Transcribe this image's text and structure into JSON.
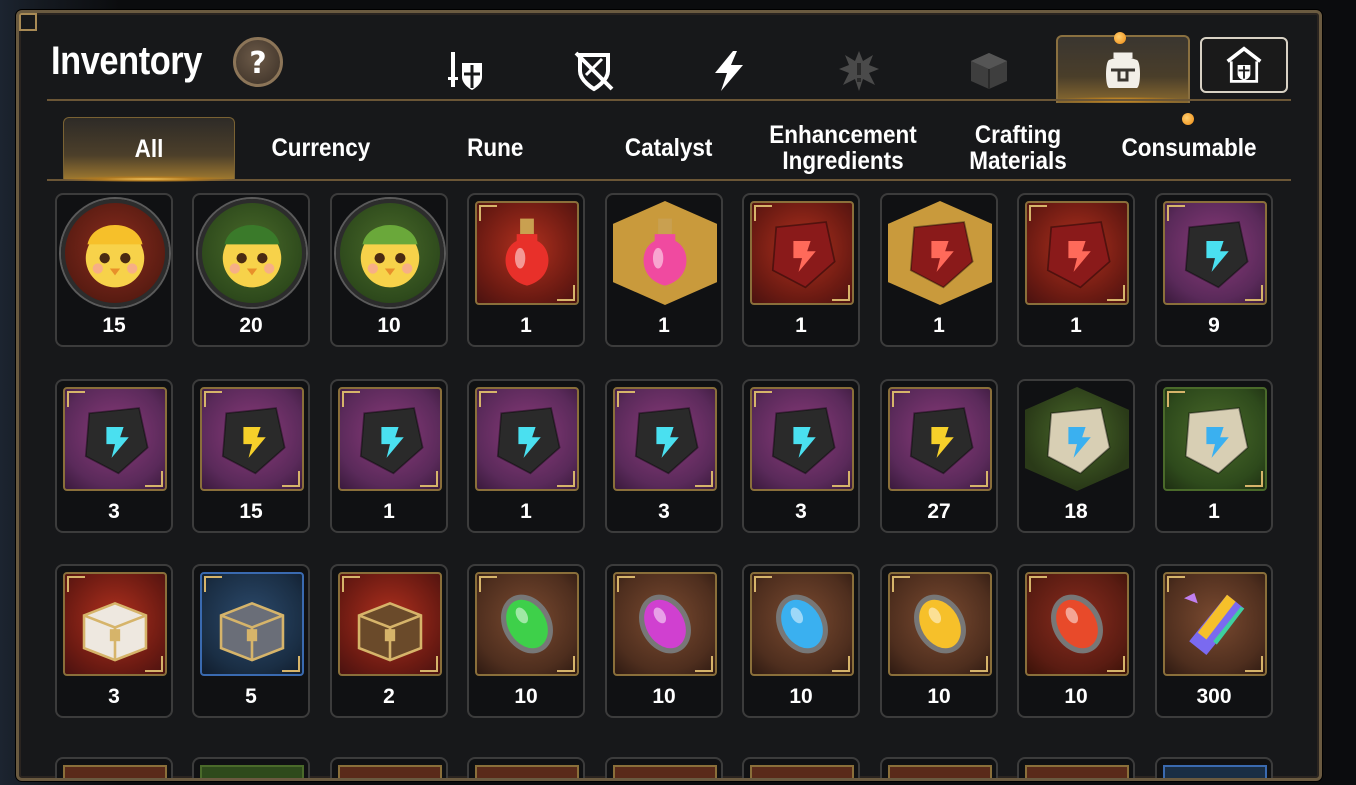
{
  "title": "Inventory",
  "help_label": "?",
  "top_tabs": [
    {
      "icon": "sword-shield-icon",
      "state": "normal"
    },
    {
      "icon": "no-shield-icon",
      "state": "normal"
    },
    {
      "icon": "lightning-icon",
      "state": "normal"
    },
    {
      "icon": "splash-icon",
      "state": "disabled"
    },
    {
      "icon": "dice-icon",
      "state": "disabled"
    },
    {
      "icon": "backpack-icon",
      "state": "active"
    },
    {
      "icon": "guild-house-icon",
      "state": "normal"
    }
  ],
  "categories": [
    {
      "label": "All",
      "active": true
    },
    {
      "label": "Currency"
    },
    {
      "label": "Rune"
    },
    {
      "label": "Catalyst"
    },
    {
      "label": "Enhancement Ingredients"
    },
    {
      "label": "Crafting Materials"
    },
    {
      "label": "Consumable"
    }
  ],
  "items": [
    {
      "count": "15",
      "icon": "golden-chick-portrait-icon",
      "frame": "circle"
    },
    {
      "count": "20",
      "icon": "green-cap-chick-portrait-icon",
      "frame": "circle"
    },
    {
      "count": "10",
      "icon": "leaf-chick-portrait-icon",
      "frame": "circle"
    },
    {
      "count": "1",
      "icon": "red-potion-bottle-icon",
      "frame": "square"
    },
    {
      "count": "1",
      "icon": "pink-potion-flask-icon",
      "frame": "hexagon"
    },
    {
      "count": "1",
      "icon": "red-rune-necklace-icon",
      "frame": "square"
    },
    {
      "count": "1",
      "icon": "red-rune-star-icon",
      "frame": "hexagon"
    },
    {
      "count": "1",
      "icon": "red-rune-ring-icon",
      "frame": "square"
    },
    {
      "count": "9",
      "icon": "blue-rune-sword-icon",
      "frame": "square"
    },
    {
      "count": "3",
      "icon": "blue-rune-helmet-icon",
      "frame": "square"
    },
    {
      "count": "15",
      "icon": "yellow-rune-exclaim-icon",
      "frame": "square"
    },
    {
      "count": "1",
      "icon": "blue-rune-ring-icon",
      "frame": "square"
    },
    {
      "count": "1",
      "icon": "blue-rune-necklace-icon",
      "frame": "square"
    },
    {
      "count": "3",
      "icon": "blue-rune-armor-icon",
      "frame": "square"
    },
    {
      "count": "3",
      "icon": "blue-rune-boot-icon",
      "frame": "square"
    },
    {
      "count": "27",
      "icon": "yellow-rune-hammer-icon",
      "frame": "square"
    },
    {
      "count": "18",
      "icon": "stone-rune-star-icon",
      "frame": "hexagon-green"
    },
    {
      "count": "1",
      "icon": "stone-rune-sword-icon",
      "frame": "square"
    },
    {
      "count": "3",
      "icon": "white-chest-icon",
      "frame": "square"
    },
    {
      "count": "5",
      "icon": "silver-chest-icon",
      "frame": "square"
    },
    {
      "count": "2",
      "icon": "wooden-chest-icon",
      "frame": "square"
    },
    {
      "count": "10",
      "icon": "green-gem-icon",
      "frame": "square"
    },
    {
      "count": "10",
      "icon": "purple-gem-icon",
      "frame": "square"
    },
    {
      "count": "10",
      "icon": "blue-gem-icon",
      "frame": "square"
    },
    {
      "count": "10",
      "icon": "yellow-gem-icon",
      "frame": "square"
    },
    {
      "count": "10",
      "icon": "red-gem-icon",
      "frame": "square"
    },
    {
      "count": "300",
      "icon": "rainbow-crystal-icon",
      "frame": "square"
    }
  ],
  "colors": {
    "frame_gold": "#8a6f3a",
    "accent": "#f3c45a",
    "panel": "#17181a"
  }
}
